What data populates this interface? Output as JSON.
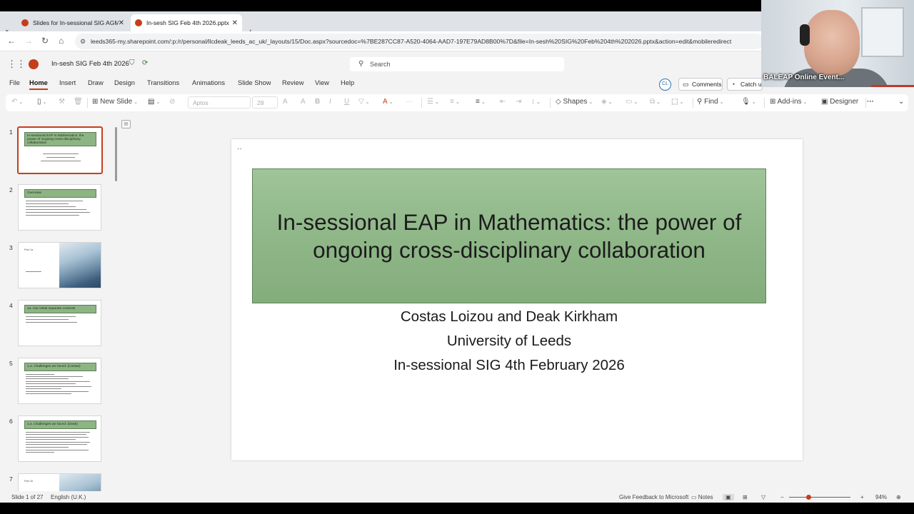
{
  "browser": {
    "tabs": [
      {
        "label": "Slides for In-sessional SIG AGM"
      },
      {
        "label": "In-sesh SIG Feb 4th 2026.pptx"
      }
    ],
    "url": "leeds365-my.sharepoint.com/:p:/r/personal/llcdeak_leeds_ac_uk/_layouts/15/Doc.aspx?sourcedoc=%7BE287CC87-A520-4064-AAD7-197E79AD8B00%7D&file=In-sesh%20SIG%20Feb%204th%202026.pptx&action=edit&mobileredirect"
  },
  "ppt": {
    "doc_title": "In-sesh SIG Feb 4th 2026",
    "search_placeholder": "Search",
    "ribbon_tabs": [
      "File",
      "Home",
      "Insert",
      "Draw",
      "Design",
      "Transitions",
      "Animations",
      "Slide Show",
      "Review",
      "View",
      "Help"
    ],
    "avatar_initials": "CL",
    "comments_label": "Comments",
    "catchup_label": "Catch up",
    "toolbar": {
      "new_slide": "New Slide",
      "font": "Aptos",
      "size": "28",
      "shapes": "Shapes",
      "find": "Find",
      "addins": "Add-ins",
      "designer": "Designer"
    }
  },
  "thumbnails": [
    {
      "num": "1",
      "title": "In-sessional EAP in Mathematics: the power of ongoing cross-disciplinary collaboration"
    },
    {
      "num": "2",
      "title": "Overview"
    },
    {
      "num": "3",
      "title": "Part 1a"
    },
    {
      "num": "4",
      "title": "1a. Our initial separate contexts"
    },
    {
      "num": "5",
      "title": "1.a. Challenges we faced: (Costas)"
    },
    {
      "num": "6",
      "title": "1.a. Challenges we faced: (Deak)"
    },
    {
      "num": "7",
      "title": "Part 1b"
    }
  ],
  "slide": {
    "title": "In-sessional EAP in Mathematics: the power of ongoing cross-disciplinary collaboration",
    "authors": "Costas Loizou and Deak Kirkham",
    "university": "University of Leeds",
    "event": "In-sessional SIG 4th February 2026"
  },
  "status": {
    "slide_count": "Slide 1 of 27",
    "language": "English (U.K.)",
    "feedback": "Give Feedback to Microsoft",
    "notes": "Notes",
    "zoom": "94%"
  },
  "webcam": {
    "label": "BALEAP Online Event..."
  }
}
